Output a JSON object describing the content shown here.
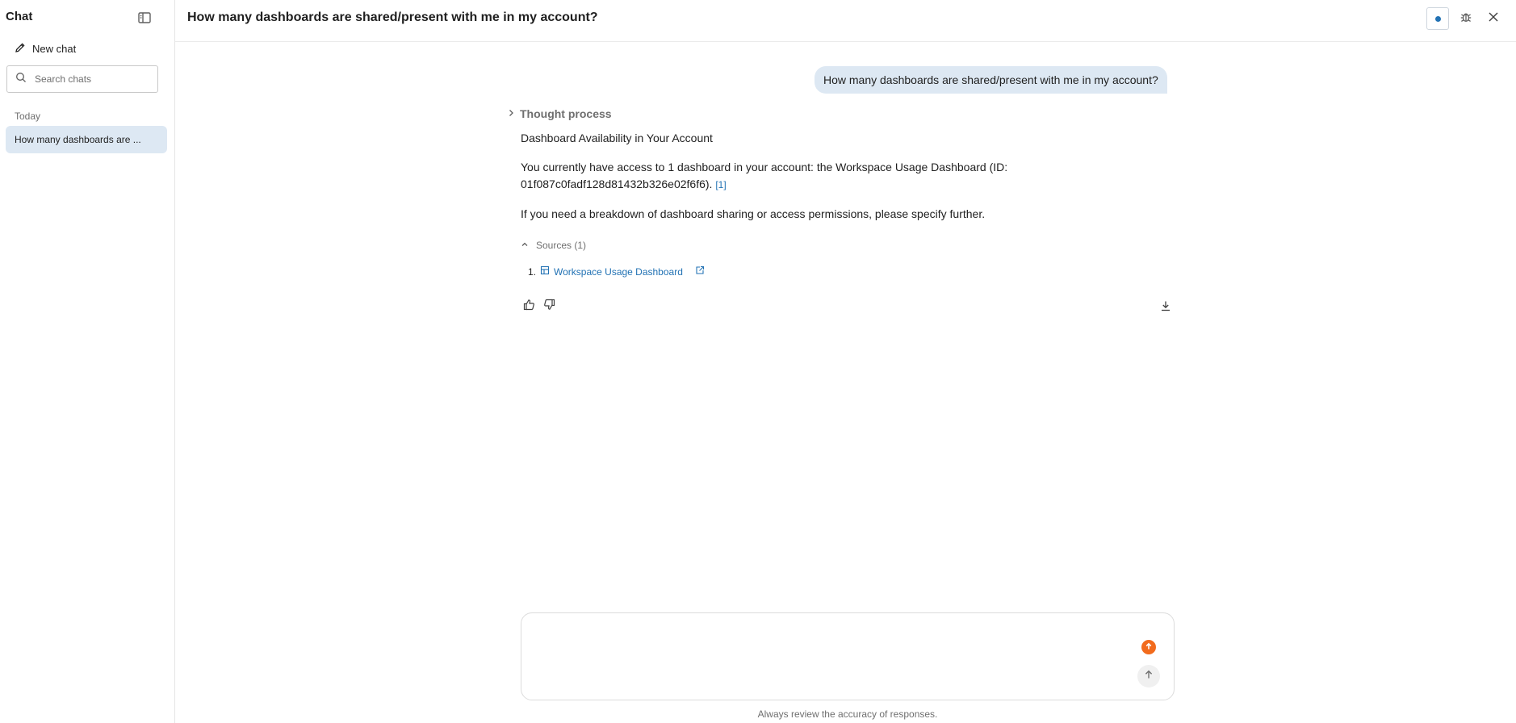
{
  "sidebar": {
    "title": "Chat",
    "new_chat_label": "New chat",
    "search_placeholder": "Search chats",
    "group_label": "Today",
    "chats": [
      {
        "label": "How many dashboards are ..."
      }
    ]
  },
  "header": {
    "title": "How many dashboards are shared/present with me in my account?"
  },
  "conversation": {
    "user_message": "How many dashboards are shared/present with me in my account?",
    "thought_label": "Thought process",
    "answer_heading": "Dashboard Availability in Your Account",
    "answer_para1": "You currently have access to 1 dashboard in your account: the Workspace Usage Dashboard (ID: 01f087c0fadf128d81432b326e02f6f6).",
    "citation": "[1]",
    "answer_para2": "If you need a breakdown of dashboard sharing or access permissions, please specify further.",
    "sources_label": "Sources (1)",
    "sources": [
      {
        "index": "1.",
        "title": "Workspace Usage Dashboard"
      }
    ]
  },
  "composer": {
    "placeholder": "",
    "disclaimer": "Always review the accuracy of responses."
  },
  "colors": {
    "accent": "#2272b4",
    "selected_bg": "#dde8f3",
    "upload": "#f26b1d"
  }
}
